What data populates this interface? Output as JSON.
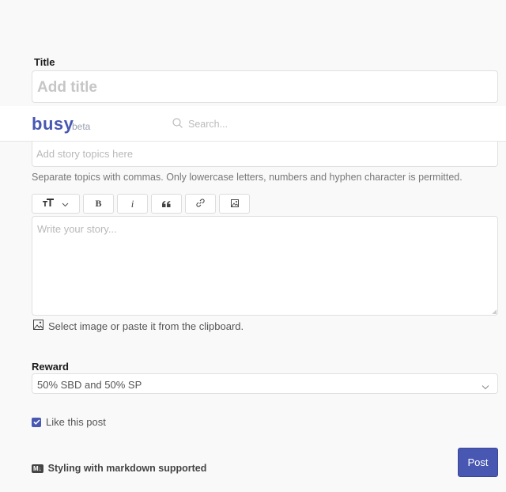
{
  "form": {
    "title_label": "Title",
    "title_placeholder": "Add title",
    "topics_placeholder": "Add story topics here",
    "topics_hint": "Separate topics with commas. Only lowercase letters, numbers and hyphen character is permitted.",
    "toolbar": [
      {
        "name": "heading",
        "icon": "text-size-icon"
      },
      {
        "name": "bold",
        "label": "B",
        "icon": "bold-icon"
      },
      {
        "name": "italic",
        "label": "i",
        "icon": "italic-icon"
      },
      {
        "name": "quote",
        "label": "“",
        "icon": "quote-icon"
      },
      {
        "name": "link",
        "icon": "link-icon"
      },
      {
        "name": "image",
        "icon": "image-icon"
      }
    ],
    "story_placeholder": "Write your story...",
    "image_hint": "Select image or paste it from the clipboard.",
    "reward_label": "Reward",
    "reward_value": "50% SBD and 50% SP",
    "like_label": "Like this post",
    "like_checked": true,
    "markdown_badge": "M↓",
    "markdown_text": "Styling with markdown supported",
    "post_label": "Post"
  },
  "header": {
    "logo": "busy",
    "logo_tag": "beta",
    "search_placeholder": "Search..."
  },
  "colors": {
    "accent": "#4757b2"
  }
}
